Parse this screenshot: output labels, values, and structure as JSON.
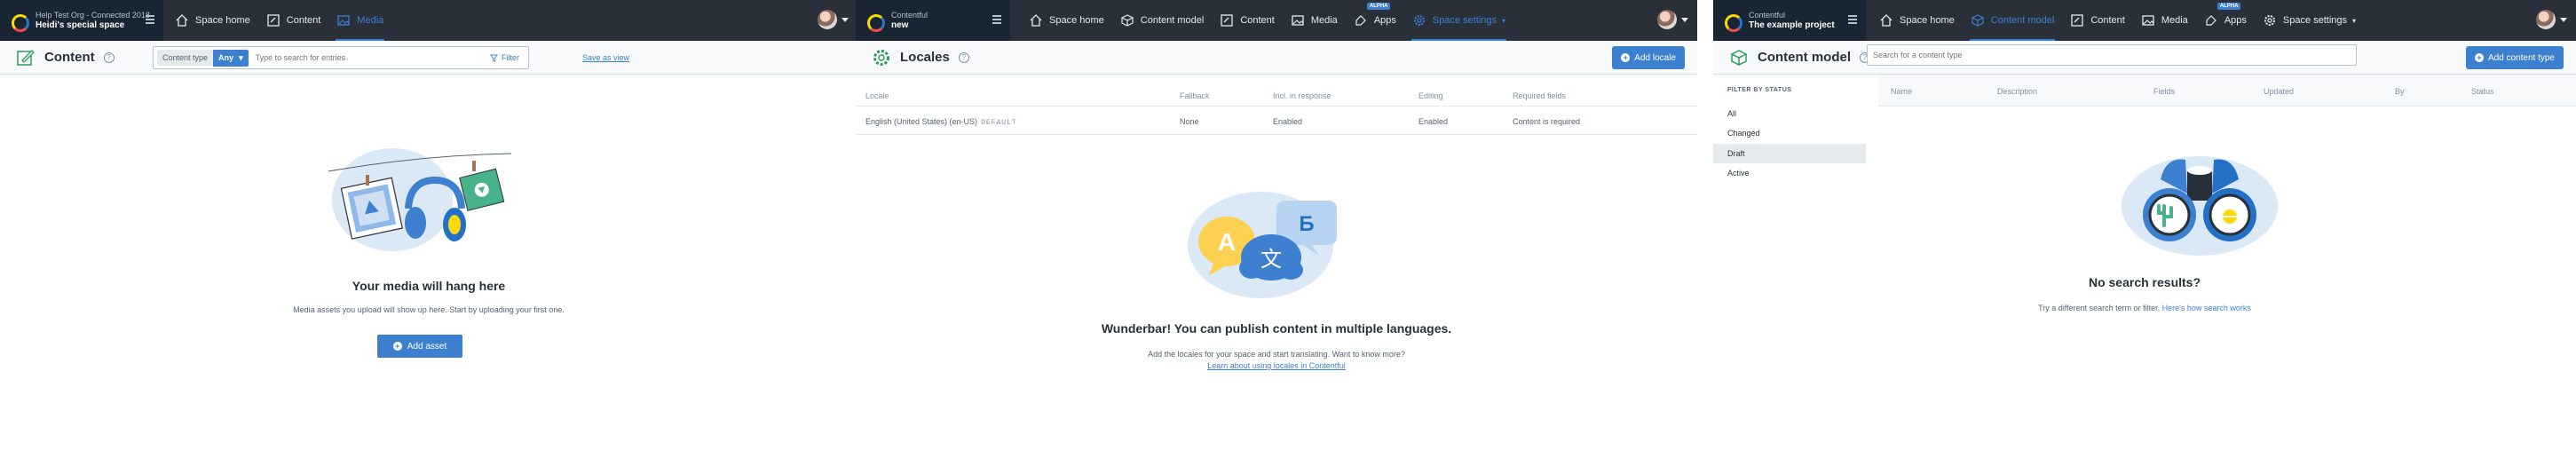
{
  "shot1": {
    "org": {
      "subtitle": "Help Test Org - Connected 2018",
      "space": "Heidi's special space"
    },
    "nav": [
      {
        "label": "Space home",
        "icon": "home-icon",
        "active": false
      },
      {
        "label": "Content",
        "icon": "content-icon",
        "active": false
      },
      {
        "label": "Media",
        "icon": "media-icon",
        "active": true
      }
    ],
    "title": "Content",
    "search": {
      "type_label": "Content type",
      "type_value": "Any",
      "placeholder": "Type to search for entries",
      "filter_label": "Filter"
    },
    "save_view": "Save as view",
    "empty": {
      "title": "Your media will hang here",
      "description": "Media assets you upload will show up here. Start by uploading your first one.",
      "button": "Add asset"
    }
  },
  "shot2": {
    "org": {
      "subtitle": "Contentful",
      "space": "new"
    },
    "nav": [
      {
        "label": "Space home",
        "icon": "home-icon",
        "active": false
      },
      {
        "label": "Content model",
        "icon": "content-model-icon",
        "active": false
      },
      {
        "label": "Content",
        "icon": "content-icon",
        "active": false
      },
      {
        "label": "Media",
        "icon": "media-icon",
        "active": false
      },
      {
        "label": "Apps",
        "icon": "apps-icon",
        "active": false,
        "badge": "ALPHA"
      },
      {
        "label": "Space settings",
        "icon": "gear-icon",
        "active": true
      }
    ],
    "title": "Locales",
    "add_button": "Add locale",
    "table": {
      "headers": [
        "Locale",
        "Fallback",
        "Incl. in response",
        "Editing",
        "Required fields"
      ],
      "row": {
        "locale": "English (United States) (en-US)",
        "tag": "DEFAULT",
        "fallback": "None",
        "incl": "Enabled",
        "editing": "Enabled",
        "required": "Content is required"
      }
    },
    "empty": {
      "title": "Wunderbar! You can publish content in multiple languages.",
      "description": "Add the locales for your space and start translating. Want to know more?",
      "link": "Learn about using locales in Contentful"
    },
    "illustration": {
      "bubble_a": "A",
      "bubble_wen": "文",
      "bubble_be": "Б"
    }
  },
  "shot3": {
    "org": {
      "subtitle": "Contentful",
      "space": "The example project"
    },
    "nav": [
      {
        "label": "Space home",
        "icon": "home-icon",
        "active": false
      },
      {
        "label": "Content model",
        "icon": "content-model-icon",
        "active": true
      },
      {
        "label": "Content",
        "icon": "content-icon",
        "active": false
      },
      {
        "label": "Media",
        "icon": "media-icon",
        "active": false
      },
      {
        "label": "Apps",
        "icon": "apps-icon",
        "active": false,
        "badge": "ALPHA"
      },
      {
        "label": "Space settings",
        "icon": "gear-icon",
        "active": false
      }
    ],
    "title": "Content model",
    "search_placeholder": "Search for a content type",
    "add_button": "Add content type",
    "filter_heading": "FILTER BY STATUS",
    "filters": [
      "All",
      "Changed",
      "Draft",
      "Active"
    ],
    "headers": [
      "Name",
      "Description",
      "Fields",
      "Updated",
      "By",
      "Status"
    ],
    "empty": {
      "title": "No search results?",
      "description": "Try a different search term or filter.",
      "link": "Here's how search works"
    }
  },
  "colors": {
    "topbar": "#2a3039",
    "accent": "#3c80cf",
    "illustration_bg": "#dbe9f7"
  }
}
